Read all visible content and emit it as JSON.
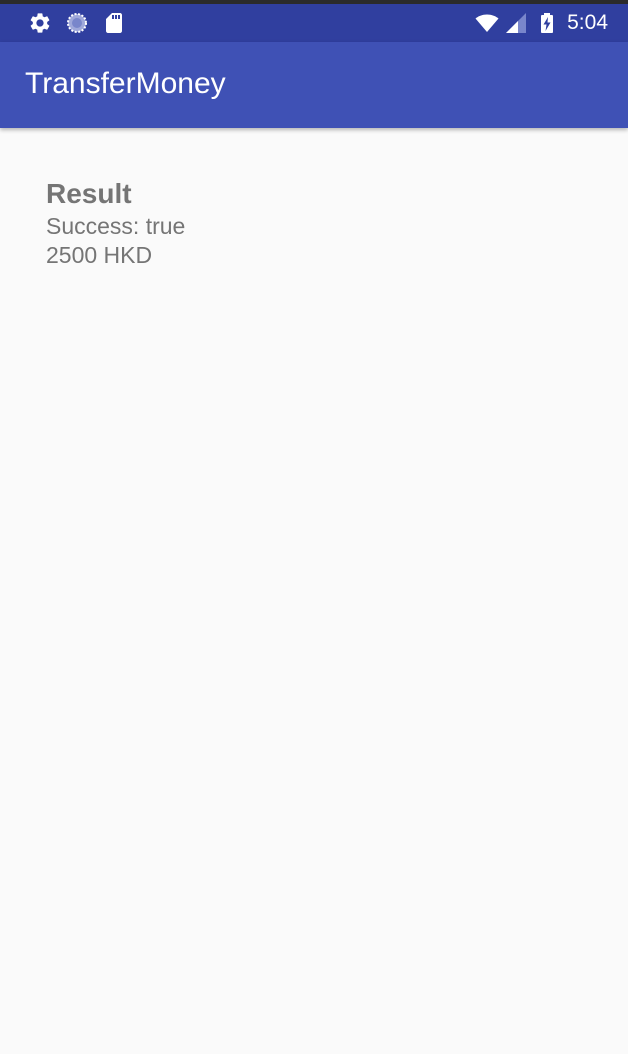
{
  "status_bar": {
    "time": "5:04",
    "icons": [
      "settings-icon",
      "sync-icon",
      "sd-card-icon",
      "wifi-icon",
      "signal-icon",
      "battery-charging-icon"
    ]
  },
  "app_bar": {
    "title": "TransferMoney"
  },
  "result": {
    "heading": "Result",
    "success_text": "Success: true",
    "amount_text": "2500 HKD"
  },
  "colors": {
    "status_bar": "#303f9f",
    "app_bar": "#3f51b5",
    "background": "#fafafa",
    "text": "#757575"
  }
}
